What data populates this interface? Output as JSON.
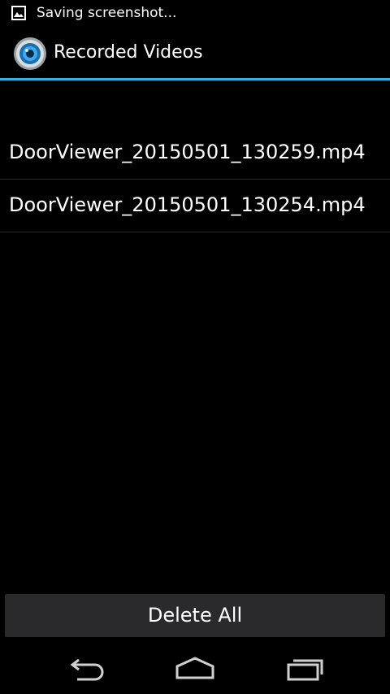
{
  "status_bar": {
    "notification_icon": "image-icon",
    "text": "Saving screenshot..."
  },
  "action_bar": {
    "app_icon": "camera-lens-icon",
    "title": "Recorded Videos"
  },
  "files": [
    "DoorViewer_20150501_130259.mp4",
    "DoorViewer_20150501_130254.mp4"
  ],
  "delete_all_label": "Delete All",
  "nav_bar": {
    "back_icon": "back-icon",
    "home_icon": "home-icon",
    "recents_icon": "recents-icon"
  },
  "colors": {
    "accent": "#33b5e5",
    "background": "#000000",
    "button": "#2a2a2c"
  }
}
